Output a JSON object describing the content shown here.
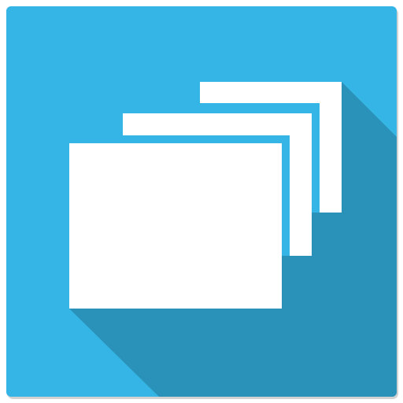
{
  "icon": {
    "name": "overlapping-windows-app-icon",
    "colors": {
      "background": "#35B5E5",
      "shadow": "#2A91B8",
      "window": "#FFFFFF",
      "outer_shadow": "#9A9A9A"
    }
  }
}
